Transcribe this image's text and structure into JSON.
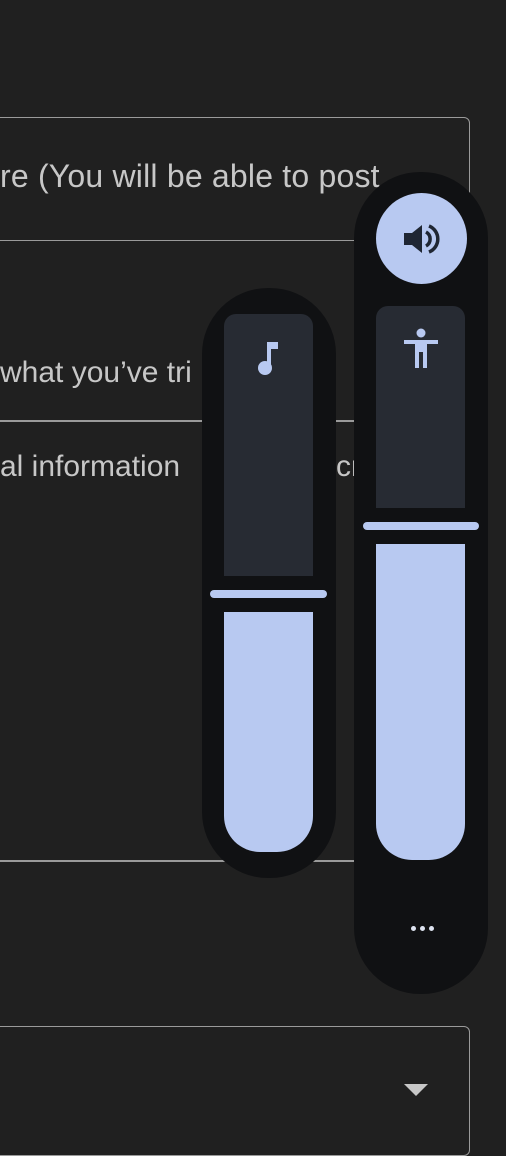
{
  "form": {
    "summary_text": "re (You will be able to post",
    "tried_text": "what you’ve tri",
    "personal_text": "al information",
    "personal_text_tail": "cr"
  },
  "volume_panel": {
    "music_stream": {
      "icon": "music-note-icon",
      "level": 0.42
    },
    "accessibility_stream": {
      "icon": "accessibility-icon",
      "level": 0.6
    },
    "ringer_icon": "volume-up-icon",
    "more_icon": "more-horiz-icon"
  },
  "colors": {
    "background": "#202020",
    "panel": "#101113",
    "accent": "#b8c9f1",
    "track": "#272b33"
  }
}
